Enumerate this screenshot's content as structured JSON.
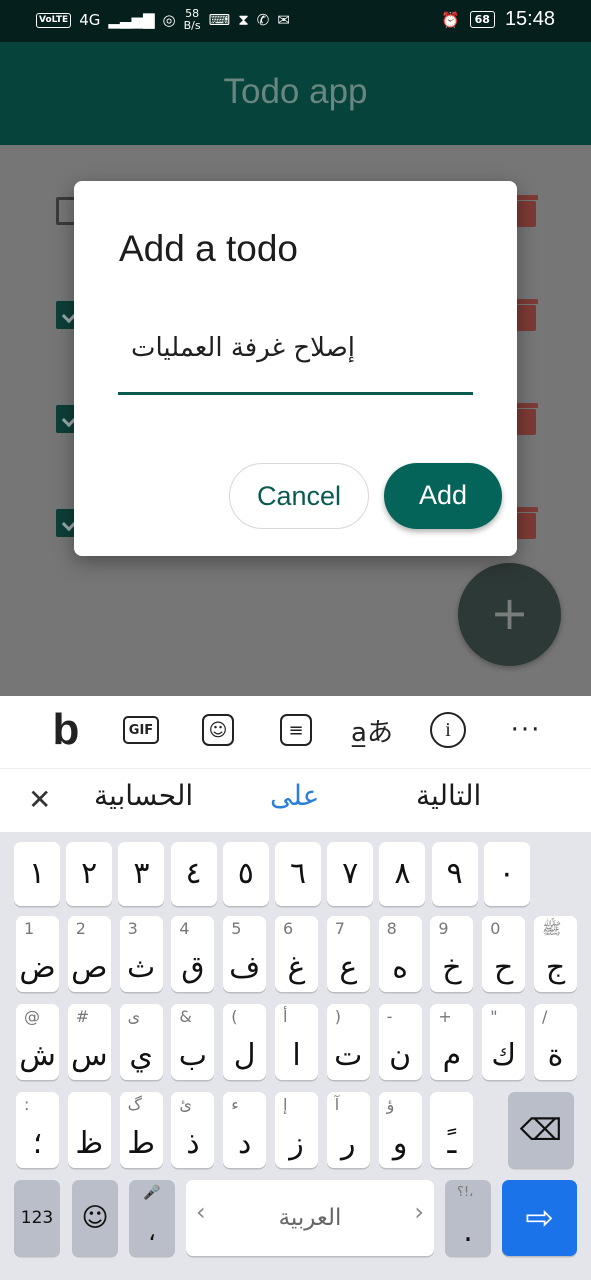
{
  "status_bar": {
    "volte": "VoLTE",
    "network": "4G",
    "speed_value": "58",
    "speed_unit": "B/s",
    "battery": "68",
    "time": "15:48"
  },
  "app": {
    "title": "Todo app"
  },
  "todos": [
    {
      "checked": false
    },
    {
      "checked": true
    },
    {
      "checked": true
    },
    {
      "checked": true
    }
  ],
  "fab": {
    "label": "+"
  },
  "dialog": {
    "title": "Add a todo",
    "input_value": "إصلاح غرفة العمليات",
    "cancel_label": "Cancel",
    "add_label": "Add"
  },
  "keyboard": {
    "toolbar": {
      "bing": "b",
      "gif": "GIF",
      "dots": "···"
    },
    "suggestions": [
      "التالية",
      "على",
      "الحسابية"
    ],
    "number_row": [
      "١",
      "٢",
      "٣",
      "٤",
      "٥",
      "٦",
      "٧",
      "٨",
      "٩",
      "٠"
    ],
    "row1": [
      {
        "hint": "1",
        "main": "ض"
      },
      {
        "hint": "2",
        "main": "ص"
      },
      {
        "hint": "3",
        "main": "ث"
      },
      {
        "hint": "4",
        "main": "ق"
      },
      {
        "hint": "5",
        "main": "ف"
      },
      {
        "hint": "6",
        "main": "غ"
      },
      {
        "hint": "7",
        "main": "ع"
      },
      {
        "hint": "8",
        "main": "ه"
      },
      {
        "hint": "9",
        "main": "خ"
      },
      {
        "hint": "0",
        "main": "ح"
      },
      {
        "hint": "ﷺ",
        "main": "ج"
      }
    ],
    "row2": [
      {
        "hint": "@",
        "main": "ش"
      },
      {
        "hint": "#",
        "main": "س"
      },
      {
        "hint": "ى",
        "main": "ي"
      },
      {
        "hint": "&",
        "main": "ب"
      },
      {
        "hint": "(",
        "main": "ل"
      },
      {
        "hint": "أ",
        "main": "ا"
      },
      {
        "hint": ")",
        "main": "ت"
      },
      {
        "hint": "-",
        "main": "ن"
      },
      {
        "hint": "+",
        "main": "م"
      },
      {
        "hint": "\"",
        "main": "ك"
      },
      {
        "hint": "/",
        "main": "ة"
      }
    ],
    "row3": [
      {
        "hint": ":",
        "main": "؛"
      },
      {
        "hint": "",
        "main": "ظ"
      },
      {
        "hint": "گ",
        "main": "ط"
      },
      {
        "hint": "ئ",
        "main": "ذ"
      },
      {
        "hint": "ء",
        "main": "د"
      },
      {
        "hint": "إ",
        "main": "ز"
      },
      {
        "hint": "آ",
        "main": "ر"
      },
      {
        "hint": "ؤ",
        "main": "و"
      },
      {
        "hint": "",
        "main": "ـً"
      }
    ],
    "bottom": {
      "mode_label": "123",
      "emoji": "☺",
      "comma": "،",
      "mic_hint": "🎤",
      "space_label": "العربية",
      "period": ".",
      "period_hint": "؟!،",
      "left_arrow": "‹",
      "right_arrow": "›"
    }
  },
  "colors": {
    "app_bar": "#06433a",
    "accent": "#05645a",
    "trash": "#7c3a35",
    "enter_key": "#1a73e8"
  }
}
